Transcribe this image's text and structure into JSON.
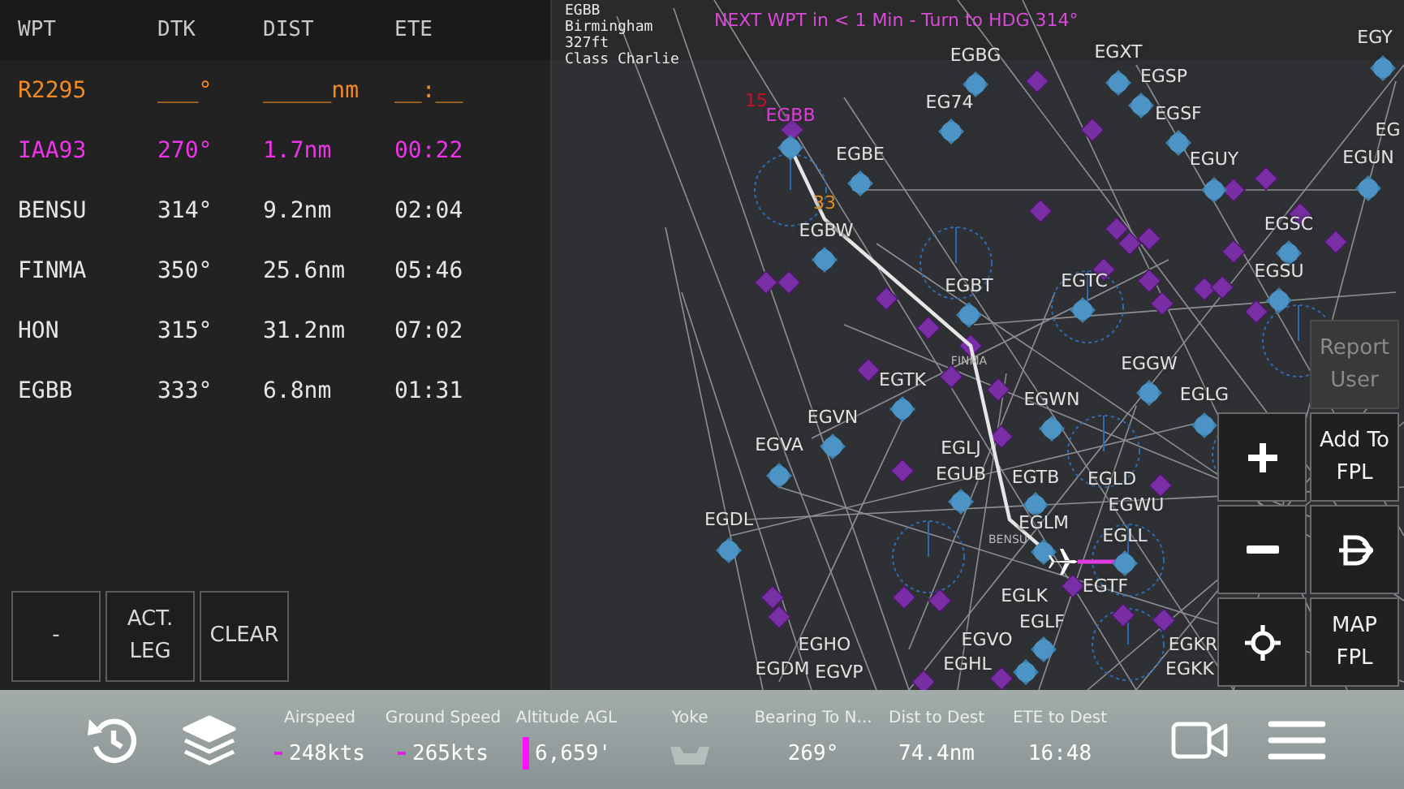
{
  "flight_plan": {
    "columns": [
      "WPT",
      "DTK",
      "DIST",
      "ETE"
    ],
    "rows": [
      {
        "kind": "pending",
        "cells": [
          "R2295",
          "___°",
          "_____nm",
          "__:__"
        ]
      },
      {
        "kind": "active",
        "cells": [
          "IAA93",
          "270°",
          "1.7nm",
          "00:22"
        ]
      },
      {
        "kind": "normal",
        "cells": [
          "BENSU",
          "314°",
          "9.2nm",
          "02:04"
        ]
      },
      {
        "kind": "normal",
        "cells": [
          "FINMA",
          "350°",
          "25.6nm",
          "05:46"
        ]
      },
      {
        "kind": "normal",
        "cells": [
          "HON",
          "315°",
          "31.2nm",
          "07:02"
        ]
      },
      {
        "kind": "normal",
        "cells": [
          "EGBB",
          "333°",
          "6.8nm",
          "01:31"
        ]
      }
    ],
    "buttons": [
      "-",
      "ACT. LEG",
      "CLEAR"
    ]
  },
  "banner": "NEXT WPT in < 1 Min - Turn to HDG 314°",
  "airport_info": [
    "EGBB",
    "Birmingham",
    "327ft",
    "Class Charlie"
  ],
  "map": {
    "runway_labels": [
      {
        "label": "15",
        "color": "#c8102e"
      },
      {
        "label": "33",
        "color": "#e0901a"
      }
    ],
    "route_labels": [
      "FINMA",
      "BENSU"
    ],
    "airports": [
      {
        "label": "EGBB",
        "active": true
      },
      {
        "label": "EGBE",
        "active": false
      },
      {
        "label": "EG74",
        "active": false
      },
      {
        "label": "EGBG",
        "active": false
      },
      {
        "label": "EGXT",
        "active": false
      },
      {
        "label": "EGSP",
        "active": false
      },
      {
        "label": "EGSF",
        "active": false
      },
      {
        "label": "EGUY",
        "active": false
      },
      {
        "label": "EGY",
        "active": false
      },
      {
        "label": "EG",
        "active": false
      },
      {
        "label": "EGUN",
        "active": false
      },
      {
        "label": "EGSC",
        "active": false
      },
      {
        "label": "EGSU",
        "active": false
      },
      {
        "label": "EGBW",
        "active": false
      },
      {
        "label": "EGBT",
        "active": false
      },
      {
        "label": "EGTC",
        "active": false
      },
      {
        "label": "EGTK",
        "active": false
      },
      {
        "label": "EGGW",
        "active": false
      },
      {
        "label": "EGLG",
        "active": false
      },
      {
        "label": "EGWN",
        "active": false
      },
      {
        "label": "EGVN",
        "active": false
      },
      {
        "label": "EGVA",
        "active": false
      },
      {
        "label": "EGLJ",
        "active": false
      },
      {
        "label": "EGUB",
        "active": false
      },
      {
        "label": "EGTB",
        "active": false
      },
      {
        "label": "EGLD",
        "active": false
      },
      {
        "label": "EGWU",
        "active": false
      },
      {
        "label": "EGLM",
        "active": false
      },
      {
        "label": "EGLL",
        "active": false
      },
      {
        "label": "EGTF",
        "active": false
      },
      {
        "label": "EGDL",
        "active": false
      },
      {
        "label": "EGLK",
        "active": false
      },
      {
        "label": "EGLF",
        "active": false
      },
      {
        "label": "EGVO",
        "active": false
      },
      {
        "label": "EGHL",
        "active": false
      },
      {
        "label": "EGHO",
        "active": false
      },
      {
        "label": "EGDM",
        "active": false
      },
      {
        "label": "EGVP",
        "active": false
      },
      {
        "label": "EGKR",
        "active": false
      },
      {
        "label": "EGKK",
        "active": false
      }
    ]
  },
  "map_buttons": [
    {
      "kind": "text",
      "label": "Report User",
      "disabled": true
    },
    {
      "kind": "zoom-in",
      "disabled": false
    },
    {
      "kind": "text",
      "label": "Add To FPL",
      "disabled": false
    },
    {
      "kind": "zoom-out",
      "disabled": false
    },
    {
      "kind": "direct-to",
      "disabled": false
    },
    {
      "kind": "center",
      "disabled": false
    },
    {
      "kind": "text",
      "label": "MAP FPL",
      "disabled": false
    }
  ],
  "bottom_bar": {
    "gauges": [
      {
        "label": "Airspeed",
        "value": "248kts",
        "kind": "dash"
      },
      {
        "label": "Ground Speed",
        "value": "265kts",
        "kind": "dash"
      },
      {
        "label": "Altitude AGL",
        "value": "6,659'",
        "kind": "bar"
      },
      {
        "label": "Yoke",
        "kind": "yoke"
      },
      {
        "label": "Bearing To N...",
        "value": "269°",
        "kind": "plain"
      },
      {
        "label": "Dist to Dest",
        "value": "74.4nm",
        "kind": "plain"
      },
      {
        "label": "ETE to Dest",
        "value": "16:48",
        "kind": "plain"
      }
    ]
  }
}
